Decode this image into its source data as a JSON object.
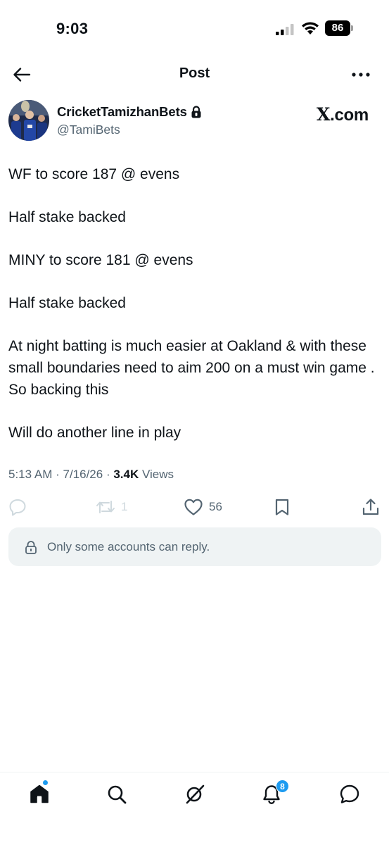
{
  "status_bar": {
    "time": "9:03",
    "battery": "86"
  },
  "header": {
    "title": "Post"
  },
  "author": {
    "display_name": "CricketTamizhanBets",
    "handle": "@TamiBets",
    "protected": true
  },
  "watermark": {
    "x": "X",
    "domain": ".com"
  },
  "post": {
    "paragraphs": [
      "WF to score 187 @ evens",
      "Half stake backed",
      "MINY to score 181 @ evens",
      "Half stake backed",
      "At night batting is much easier at Oakland & with these small boundaries need to aim 200 on a must win game . So backing this",
      "Will do another line in play"
    ]
  },
  "meta": {
    "time": "5:13 AM",
    "separator": " · ",
    "date": "7/16/26",
    "views_count": "3.4K",
    "views_label": " Views"
  },
  "actions": {
    "reply_icon": "reply-icon",
    "repost_icon": "repost-icon",
    "repost_count": "1",
    "like_icon": "heart-icon",
    "like_count": "56",
    "bookmark_icon": "bookmark-icon",
    "share_icon": "share-icon"
  },
  "reply_restriction": {
    "text": "Only some accounts can reply."
  },
  "bottom_nav": {
    "items": [
      "home-icon",
      "search-icon",
      "grok-icon",
      "bell-icon",
      "messages-icon"
    ],
    "notification_count": "8"
  },
  "colors": {
    "text": "#0f1419",
    "secondary": "#536471",
    "muted": "#cfd9de",
    "accent": "#1d9bf0",
    "reply_box_bg": "#eff3f4"
  }
}
